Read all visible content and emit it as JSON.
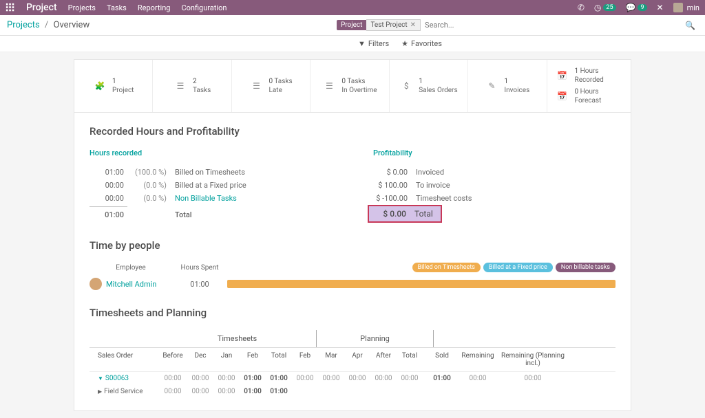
{
  "topbar": {
    "app": "Project",
    "nav": [
      "Projects",
      "Tasks",
      "Reporting",
      "Configuration"
    ],
    "badge1": "25",
    "badge2": "9",
    "user": "min"
  },
  "breadcrumb": {
    "root": "Projects",
    "current": "Overview"
  },
  "search": {
    "tag": "Project",
    "tag_value": "Test Project",
    "placeholder": "Search..."
  },
  "filterbar": {
    "filters": "Filters",
    "favorites": "Favorites"
  },
  "stats": [
    {
      "num": "1",
      "label": "Project"
    },
    {
      "num": "2",
      "label": "Tasks"
    },
    {
      "num": "0",
      "label": "Tasks",
      "sub": "Late"
    },
    {
      "num": "0",
      "label": "Tasks",
      "sub": "In Overtime"
    },
    {
      "num": "1",
      "label": "Sales Orders"
    },
    {
      "num": "1",
      "label": "Invoices"
    }
  ],
  "stats_hours": {
    "r_num": "1",
    "r_label": "Hours",
    "r_sub": "Recorded",
    "f_num": "0",
    "f_label": "Hours",
    "f_sub": "Forecast"
  },
  "section1": {
    "title": "Recorded Hours and Profitability",
    "hours_head": "Hours recorded",
    "hours_rows": [
      {
        "v1": "01:00",
        "v2": "(100.0 %)",
        "lbl": "Billed on Timesheets"
      },
      {
        "v1": "00:00",
        "v2": "(0.0 %)",
        "lbl": "Billed at a Fixed price"
      },
      {
        "v1": "00:00",
        "v2": "(0.0 %)",
        "lbl": "Non Billable Tasks",
        "link": true
      }
    ],
    "hours_total": {
      "v1": "01:00",
      "lbl": "Total"
    },
    "prof_head": "Profitability",
    "prof_rows": [
      {
        "v1": "$ 0.00",
        "lbl": "Invoiced"
      },
      {
        "v1": "$ 100.00",
        "lbl": "To invoice"
      },
      {
        "v1": "$ -100.00",
        "lbl": "Timesheet costs"
      }
    ],
    "prof_total": {
      "v1": "$ 0.00",
      "lbl": "Total"
    }
  },
  "section2": {
    "title": "Time by people",
    "emp_head": "Employee",
    "hrs_head": "Hours Spent",
    "chips": [
      "Billed on Timesheets",
      "Billed at a Fixed price",
      "Non billable tasks"
    ],
    "person": {
      "name": "Mitchell Admin",
      "hours": "01:00"
    }
  },
  "section3": {
    "title": "Timesheets and Planning",
    "ts_label": "Timesheets",
    "pl_label": "Planning",
    "cols": {
      "so": "Sales Order",
      "before": "Before",
      "dec": "Dec",
      "jan": "Jan",
      "feb": "Feb",
      "total": "Total",
      "feb2": "Feb",
      "mar": "Mar",
      "apr": "Apr",
      "after": "After",
      "total2": "Total",
      "sold": "Sold",
      "rem": "Remaining",
      "rpi": "Remaining (Planning incl.)"
    },
    "rows": [
      {
        "so": "S00063",
        "expand": "down",
        "d": [
          "00:00",
          "00:00",
          "00:00",
          "01:00",
          "01:00",
          "00:00",
          "00:00",
          "00:00",
          "00:00",
          "00:00",
          "01:00",
          "00:00",
          "00:00"
        ]
      },
      {
        "so": "Field Service",
        "expand": "right",
        "d": [
          "00:00",
          "00:00",
          "00:00",
          "01:00",
          "01:00",
          "",
          "",
          "",
          "",
          "",
          "",
          "",
          ""
        ]
      }
    ]
  }
}
